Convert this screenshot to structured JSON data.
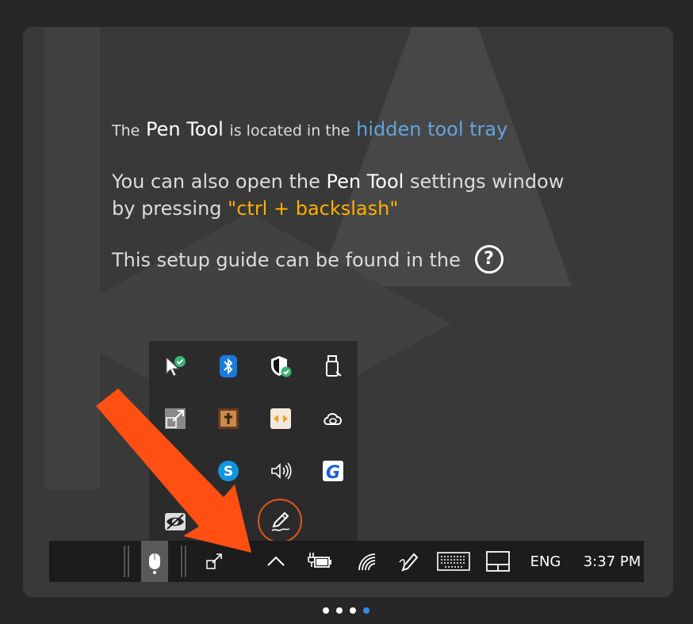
{
  "message": {
    "line1": {
      "pre": "The",
      "tool_name": "Pen Tool",
      "mid": "is located in the",
      "link": "hidden tool tray"
    },
    "line2": {
      "pre": "You can also open the",
      "tool_name": "Pen Tool",
      "post": "settings window"
    },
    "line3": {
      "pre": "by pressing",
      "shortcut": "\"ctrl + backslash\""
    },
    "line4": {
      "pre": "This setup guide can be found in the",
      "help_glyph": "?"
    }
  },
  "tray_icons": [
    "cursor-check-icon",
    "bluetooth-icon",
    "security-shield-icon",
    "usb-device-icon",
    "display-resize-icon",
    "calendar-app-icon",
    "transfer-app-icon",
    "creative-cloud-icon",
    "skype-icon",
    "volume-icon",
    "grammarly-icon",
    "eye-icon",
    "pen-tool-icon"
  ],
  "taskbar": {
    "language": "ENG",
    "time": "3:37 PM"
  },
  "carousel": {
    "pages": 4,
    "active": 4
  },
  "colors": {
    "background": "#272727",
    "card": "#393939",
    "link_blue": "#62a5de",
    "shortcut_orange": "#ffb000",
    "arrow_orange": "#ff4f12",
    "highlight_ring": "#e2561f",
    "active_dot": "#2f8ee8"
  }
}
